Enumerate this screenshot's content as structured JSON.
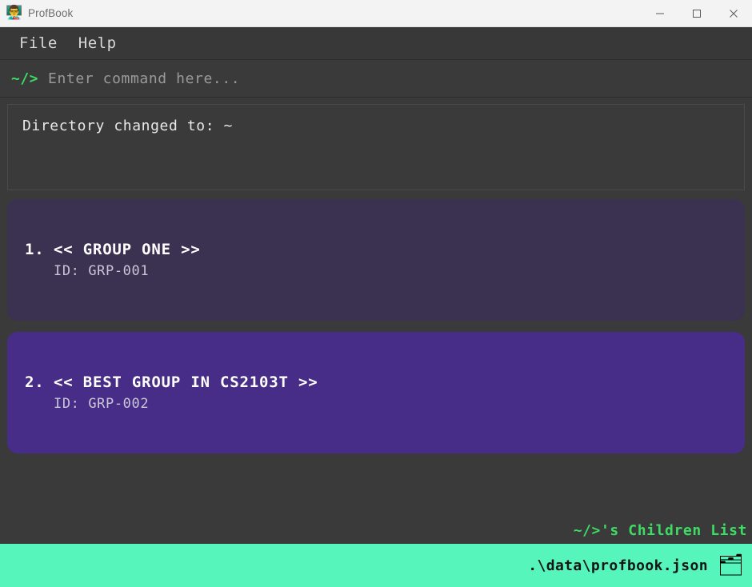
{
  "window": {
    "title": "ProfBook",
    "icon": "professor-icon",
    "controls": {
      "minimize": "minimize-icon",
      "maximize": "maximize-icon",
      "close": "close-icon"
    }
  },
  "menubar": {
    "items": [
      {
        "label": "File"
      },
      {
        "label": "Help"
      }
    ]
  },
  "command": {
    "prompt": "~/>",
    "placeholder": "Enter command here...",
    "value": ""
  },
  "result": {
    "text": "Directory changed to: ~"
  },
  "children_list": {
    "tag": "~/>'s Children List",
    "cards": [
      {
        "index": "1.",
        "title": "<< GROUP ONE >>",
        "subtitle": "ID: GRP-001",
        "tone": "tone-muted"
      },
      {
        "index": "2.",
        "title": "<< BEST GROUP IN CS2103T >>",
        "subtitle": "ID: GRP-002",
        "tone": "tone-bright"
      }
    ]
  },
  "statusbar": {
    "path": ".\\data\\profbook.json",
    "icon": "card-index-dividers-icon",
    "icon_glyph": "🗂"
  },
  "colors": {
    "background": "#3a3a3a",
    "menubar": "#383838",
    "titlebar": "#f3f3f3",
    "prompt_green": "#3ddc64",
    "card_muted": "#3b3151",
    "card_bright": "#472d87",
    "status_green": "#55f5bb"
  }
}
